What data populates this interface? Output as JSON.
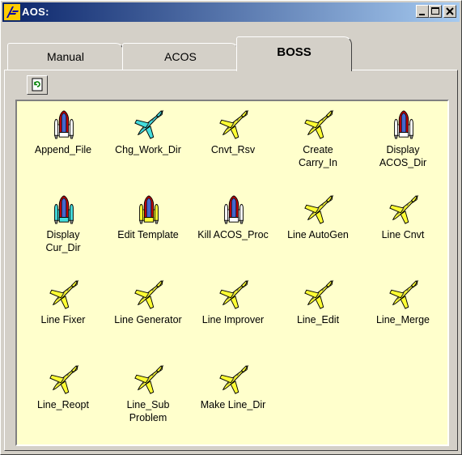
{
  "window": {
    "title": "AOS:"
  },
  "tabs": [
    {
      "label": "Manual",
      "active": false
    },
    {
      "label": "ACOS",
      "active": false
    },
    {
      "label": "BOSS",
      "active": true
    }
  ],
  "items": [
    {
      "label": "Append_File",
      "icon": "shuttle-icon",
      "color": "#ffffff"
    },
    {
      "label": "Chg_Work_Dir",
      "icon": "plane-icon",
      "color": "#44dddd"
    },
    {
      "label": "Cnvt_Rsv",
      "icon": "plane-icon",
      "color": "#ffff33"
    },
    {
      "label": "Create\nCarry_In",
      "icon": "plane-icon",
      "color": "#ffff33"
    },
    {
      "label": "Display\nACOS_Dir",
      "icon": "shuttle-icon",
      "color": "#ffffff"
    },
    {
      "label": "Display\nCur_Dir",
      "icon": "shuttle-icon",
      "color": "#44dddd"
    },
    {
      "label": "Edit Template",
      "icon": "shuttle-icon",
      "color": "#ffff33"
    },
    {
      "label": "Kill ACOS_Proc",
      "icon": "shuttle-icon",
      "color": "#ffffff"
    },
    {
      "label": "Line AutoGen",
      "icon": "plane-icon",
      "color": "#ffff33"
    },
    {
      "label": "Line Cnvt",
      "icon": "plane-icon",
      "color": "#ffff33"
    },
    {
      "label": "Line Fixer",
      "icon": "plane-icon",
      "color": "#ffff33"
    },
    {
      "label": "Line Generator",
      "icon": "plane-icon",
      "color": "#ffff33"
    },
    {
      "label": "Line Improver",
      "icon": "plane-icon",
      "color": "#ffff33"
    },
    {
      "label": "Line_Edit",
      "icon": "plane-icon",
      "color": "#ffff33"
    },
    {
      "label": "Line_Merge",
      "icon": "plane-icon",
      "color": "#ffff33"
    },
    {
      "label": "Line_Reopt",
      "icon": "plane-icon",
      "color": "#ffff33"
    },
    {
      "label": "Line_Sub\nProblem",
      "icon": "plane-icon",
      "color": "#ffff33"
    },
    {
      "label": "Make Line_Dir",
      "icon": "plane-icon",
      "color": "#ffff33"
    }
  ]
}
